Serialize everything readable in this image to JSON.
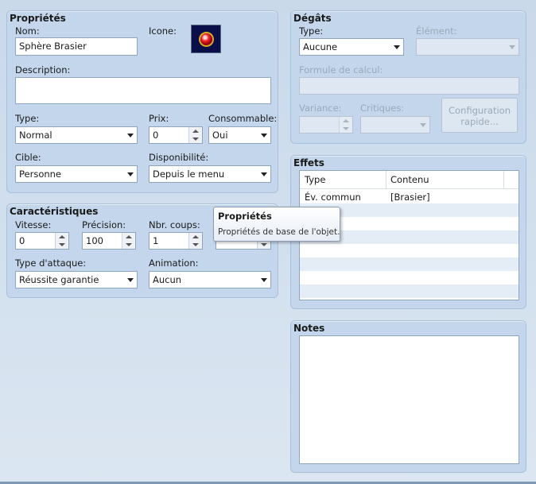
{
  "properties": {
    "title": "Propriétés",
    "name_label": "Nom:",
    "name_value": "Sphère Brasier",
    "icon_label": "Icone:",
    "icon": "red-orb-icon",
    "description_label": "Description:",
    "description_value": "",
    "type_label": "Type:",
    "type_value": "Normal",
    "price_label": "Prix:",
    "price_value": "0",
    "consumable_label": "Consommable:",
    "consumable_value": "Oui",
    "target_label": "Cible:",
    "target_value": "Personne",
    "availability_label": "Disponibilité:",
    "availability_value": "Depuis le menu"
  },
  "characteristics": {
    "title": "Caractéristiques",
    "speed_label": "Vitesse:",
    "speed_value": "0",
    "precision_label": "Précision:",
    "precision_value": "100",
    "hits_label": "Nbr. coups:",
    "hits_value": "1",
    "attack_type_label": "Type d'attaque:",
    "attack_type_value": "Réussite garantie",
    "animation_label": "Animation:",
    "animation_value": "Aucun"
  },
  "damage": {
    "title": "Dégâts",
    "type_label": "Type:",
    "type_value": "Aucune",
    "element_label": "Élément:",
    "element_value": "",
    "formula_label": "Formule de calcul:",
    "formula_value": "",
    "variance_label": "Variance:",
    "variance_value": "",
    "critical_label": "Critiques:",
    "critical_value": "",
    "quick_config_label": "Configuration rapide..."
  },
  "effects": {
    "title": "Effets",
    "columns": [
      "Type",
      "Contenu"
    ],
    "rows": [
      {
        "type": "Év. commun",
        "content": "[Brasier]"
      }
    ]
  },
  "notes": {
    "title": "Notes",
    "value": ""
  },
  "tooltip": {
    "title": "Propriétés",
    "text": "Propriétés de base de l'objet."
  }
}
